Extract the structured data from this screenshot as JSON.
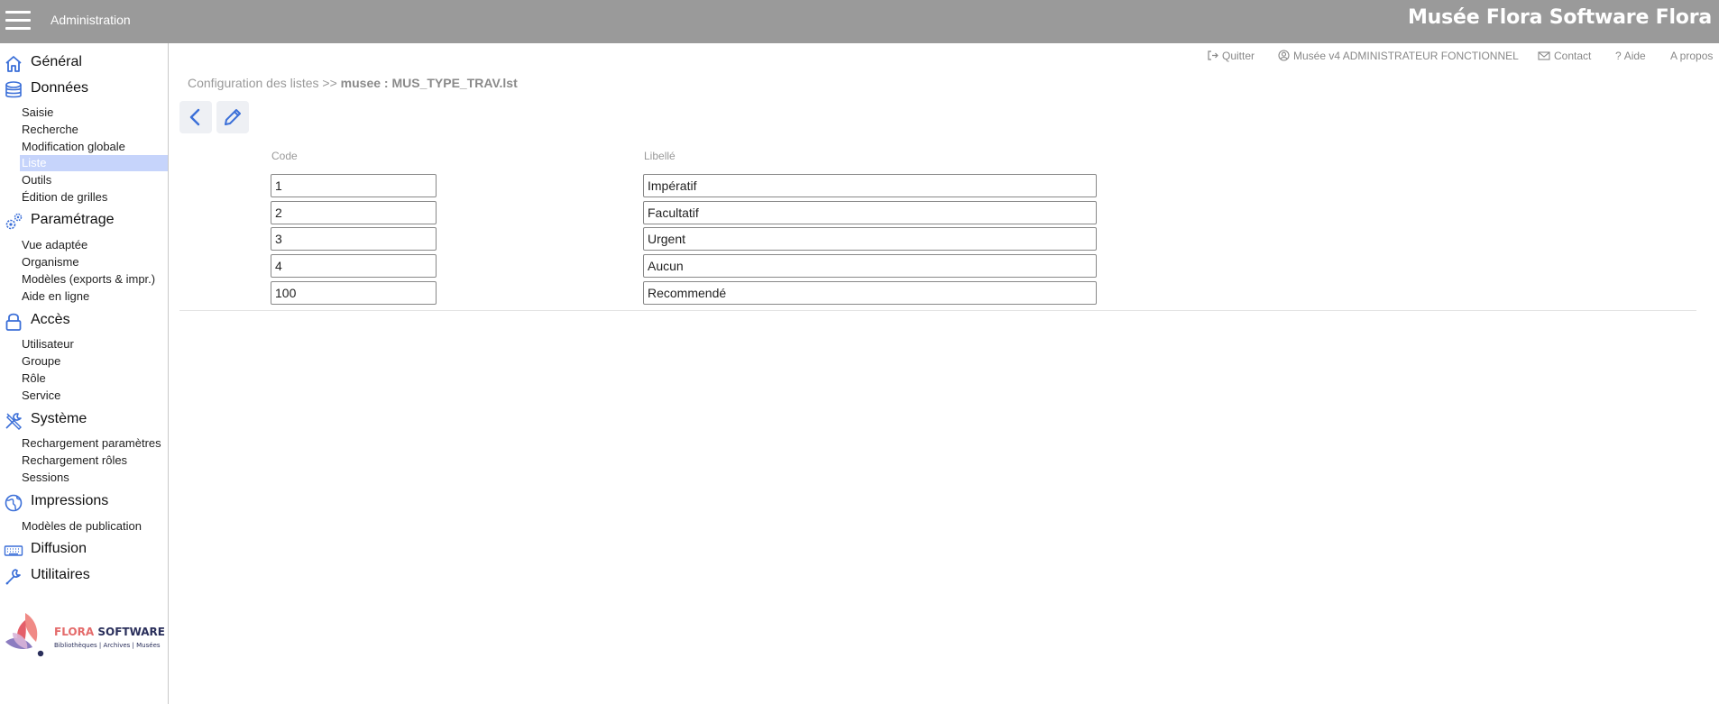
{
  "topbar": {
    "app_title": "Administration",
    "brand": "Musée Flora Software Flora"
  },
  "sidebar": {
    "sections": [
      {
        "label": "Général",
        "icon": "home-icon",
        "items": []
      },
      {
        "label": "Données",
        "icon": "database-icon",
        "items": [
          "Saisie",
          "Recherche",
          "Modification globale",
          "Liste",
          "Outils",
          "Édition de grilles"
        ]
      },
      {
        "label": "Paramétrage",
        "icon": "gears-icon",
        "items": [
          "Vue adaptée",
          "Organisme",
          "Modèles (exports & impr.)",
          "Aide en ligne"
        ]
      },
      {
        "label": "Accès",
        "icon": "lock-icon",
        "items": [
          "Utilisateur",
          "Groupe",
          "Rôle",
          "Service"
        ]
      },
      {
        "label": "Système",
        "icon": "tools-icon",
        "items": [
          "Rechargement paramètres",
          "Rechargement rôles",
          "Sessions"
        ]
      },
      {
        "label": "Impressions",
        "icon": "globe-icon",
        "items": [
          "Modèles de publication"
        ]
      },
      {
        "label": "Diffusion",
        "icon": "keyboard-icon",
        "items": []
      },
      {
        "label": "Utilitaires",
        "icon": "wrench-icon",
        "items": []
      }
    ],
    "active_item": "Liste",
    "logo": {
      "name_part1": "FLORA",
      "name_part2": "SOFTWARE",
      "tagline": "Bibliothèques | Archives | Musées"
    }
  },
  "header_links": {
    "quit": "Quitter",
    "user": "Musée v4 ADMINISTRATEUR FONCTIONNEL",
    "contact": "Contact",
    "help": "Aide",
    "about": "A propos"
  },
  "breadcrumb": {
    "parent": "Configuration des listes",
    "separator": ">>",
    "current": "musee : MUS_TYPE_TRAV.lst"
  },
  "table": {
    "headers": {
      "code": "Code",
      "libelle": "Libellé"
    },
    "rows": [
      {
        "code": "1",
        "libelle": "Impératif"
      },
      {
        "code": "2",
        "libelle": "Facultatif"
      },
      {
        "code": "3",
        "libelle": "Urgent"
      },
      {
        "code": "4",
        "libelle": "Aucun"
      },
      {
        "code": "100",
        "libelle": "Recommendé"
      }
    ]
  },
  "colors": {
    "topbar": "#9a9a9a",
    "accent": "#3b6fd8",
    "active_item_bg": "#c6d4fb"
  }
}
